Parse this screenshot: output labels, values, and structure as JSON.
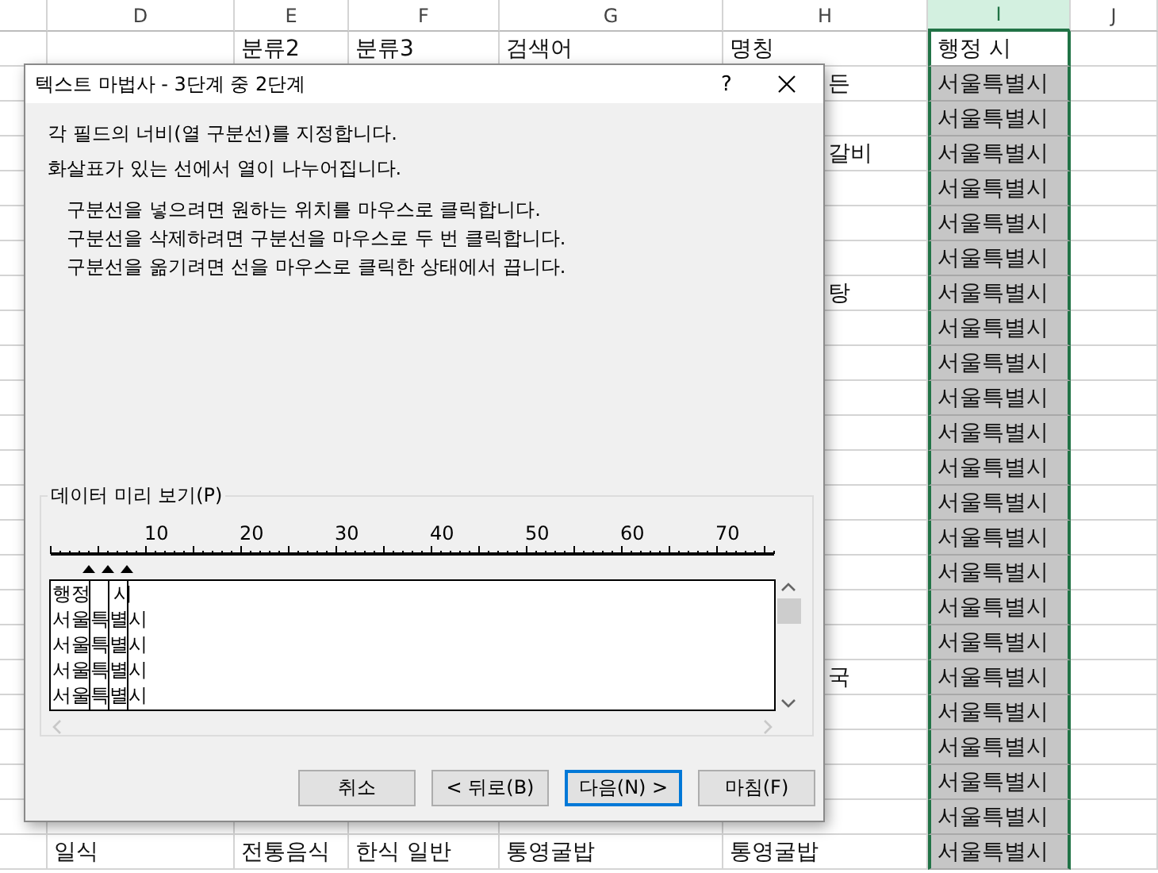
{
  "sheet": {
    "columns": [
      {
        "label": "D",
        "selected": false
      },
      {
        "label": "E",
        "selected": false
      },
      {
        "label": "F",
        "selected": false
      },
      {
        "label": "G",
        "selected": false
      },
      {
        "label": "H",
        "selected": false
      },
      {
        "label": "I",
        "selected": true
      },
      {
        "label": "J",
        "selected": false
      }
    ],
    "rows": [
      {
        "E": "분류2",
        "F": "분류3",
        "G": "검색어",
        "H": "명칭",
        "I": "행정 시",
        "active": true
      },
      {
        "H": "든",
        "H_partial": true,
        "I": "서울특별시"
      },
      {
        "I": "서울특별시"
      },
      {
        "H": "갈비",
        "H_partial": true,
        "I": "서울특별시"
      },
      {
        "I": "서울특별시"
      },
      {
        "I": "서울특별시"
      },
      {
        "I": "서울특별시"
      },
      {
        "H": "탕",
        "H_partial": true,
        "I": "서울특별시"
      },
      {
        "I": "서울특별시"
      },
      {
        "I": "서울특별시"
      },
      {
        "I": "서울특별시"
      },
      {
        "I": "서울특별시"
      },
      {
        "I": "서울특별시"
      },
      {
        "I": "서울특별시"
      },
      {
        "I": "서울특별시"
      },
      {
        "I": "서울특별시"
      },
      {
        "I": "서울특별시"
      },
      {
        "I": "서울특별시"
      },
      {
        "H": "국",
        "H_partial": true,
        "I": "서울특별시"
      },
      {
        "I": "서울특별시"
      },
      {
        "I": "서울특별시"
      },
      {
        "I": "서울특별시"
      },
      {
        "I": "서울특별시"
      },
      {
        "D": "일식",
        "E": "전통음식",
        "F": "한식 일반",
        "G": "통영굴밥",
        "H": "통영굴밥",
        "I": "서울특별시"
      }
    ]
  },
  "dialog": {
    "title": "텍스트 마법사 - 3단계 중 2단계",
    "help": "?",
    "intro": [
      "각 필드의 너비(열 구분선)를 지정합니다.",
      "화살표가 있는 선에서 열이 나누어집니다."
    ],
    "instructions": [
      "구분선을 넣으려면 원하는 위치를 마우스로 클릭합니다.",
      "구분선을 삭제하려면 구분선을 마우스로 두 번 클릭합니다.",
      "구분선을 옮기려면 선을 마우스로 클릭한 상태에서 끕니다."
    ],
    "preview": {
      "label": "데이터 미리 보기(P)",
      "ruler_labels": [
        "10",
        "20",
        "30",
        "40",
        "50",
        "60",
        "70"
      ],
      "column_breaks": [
        {
          "level": 0.0526
        },
        {
          "level": 0.0789
        },
        {
          "level": 0.1053
        }
      ],
      "lines": [
        "행정  시",
        "서울특별시",
        "서울특별시",
        "서울특별시",
        "서울특별시"
      ]
    },
    "buttons": [
      {
        "label": "취소",
        "default": false
      },
      {
        "label": "< 뒤로(B)",
        "default": false
      },
      {
        "label": "다음(N) >",
        "default": true
      },
      {
        "label": "마침(F)",
        "default": false
      }
    ]
  }
}
